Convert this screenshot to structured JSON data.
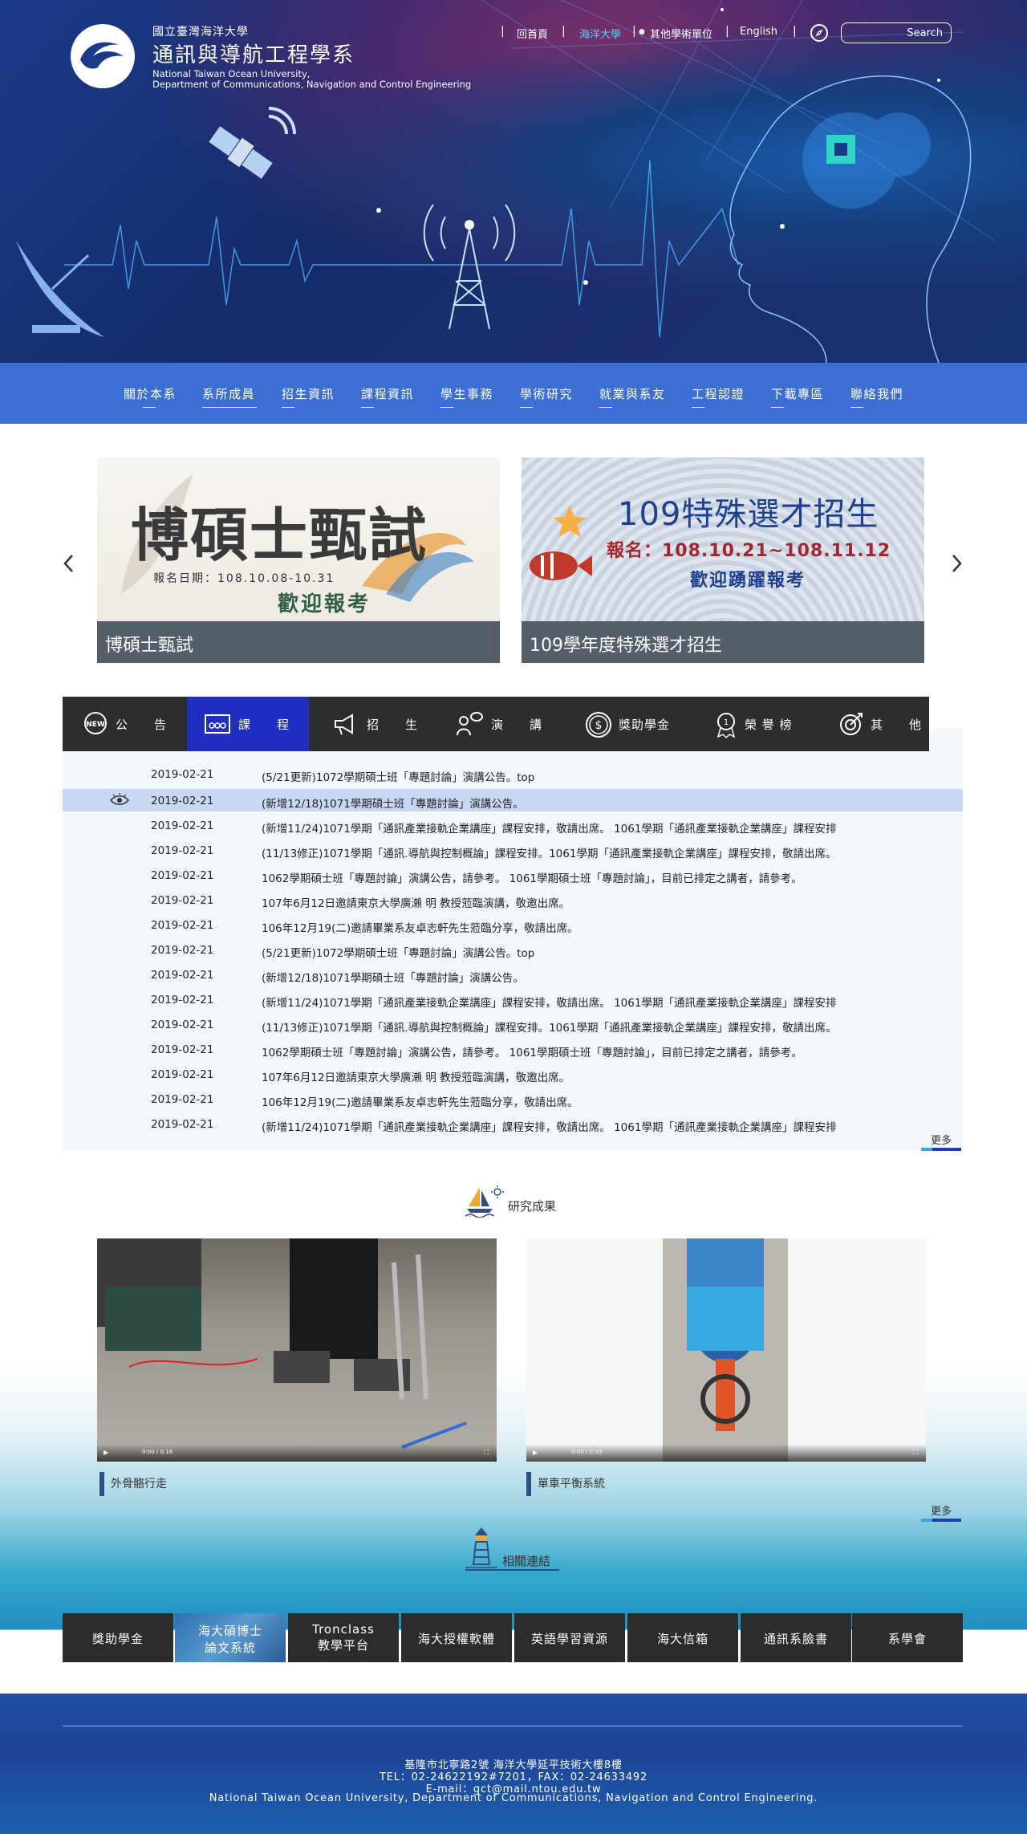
{
  "header": {
    "uni_zh": "國立臺灣海洋大學",
    "dept_zh": "通訊與導航工程學系",
    "uni_en": "National Taiwan Ocean University,",
    "dept_en": "Department of Communications, Navigation and Control Engineering",
    "topnav": [
      "回首頁",
      "海洋大學",
      "其他學術單位",
      "English"
    ],
    "search_label": "Search",
    "accent": "#4fd1ff"
  },
  "mainnav": [
    "關於本系",
    "系所成員",
    "招生資訊",
    "課程資訊",
    "學生事務",
    "學術研究",
    "就業與系友",
    "工程認證",
    "下載專區",
    "聯絡我們"
  ],
  "slides": [
    {
      "title": "博碩士甄試",
      "img_title": "博碩士甄試",
      "img_sub": "報名日期：108.10.08-10.31",
      "img_welcome": "歡迎報考"
    },
    {
      "title": "109學年度特殊選才招生",
      "img_title": "109特殊選才招生",
      "img_sub": "報名：108.10.21~108.11.12",
      "img_welcome": "歡迎踴躍報考"
    }
  ],
  "tabs": [
    "公　　告",
    "課　　程",
    "招　　生",
    "演　　講",
    "獎助學金",
    "榮 譽 榜",
    "其　　他"
  ],
  "news": [
    {
      "date": "2019-02-21",
      "title": "(5/21更新)1072學期碩士班「專題討論」演講公告。top"
    },
    {
      "date": "2019-02-21",
      "title": "(新增12/18)1071學期碩士班「專題討論」演講公告。"
    },
    {
      "date": "2019-02-21",
      "title": "(新增11/24)1071學期「通訊產業接軌企業講座」課程安排，敬請出席。 1061學期「通訊產業接軌企業講座」課程安排"
    },
    {
      "date": "2019-02-21",
      "title": "(11/13修正)1071學期「通訊.導航與控制概論」課程安排。1061學期「通訊產業接軌企業講座」課程安排，敬請出席。"
    },
    {
      "date": "2019-02-21",
      "title": "1062學期碩士班「專題討論」演講公告，請參考。 1061學期碩士班「專題討論」，目前已排定之講者，請參考。"
    },
    {
      "date": "2019-02-21",
      "title": "107年6月12日邀請東京大學廣瀨 明 教授蒞臨演講，敬邀出席。"
    },
    {
      "date": "2019-02-21",
      "title": "106年12月19(二)邀請畢業系友卓志軒先生蒞臨分享，敬請出席。"
    },
    {
      "date": "2019-02-21",
      "title": "(5/21更新)1072學期碩士班「專題討論」演講公告。top"
    },
    {
      "date": "2019-02-21",
      "title": "(新增12/18)1071學期碩士班「專題討論」演講公告。"
    },
    {
      "date": "2019-02-21",
      "title": "(新增11/24)1071學期「通訊產業接軌企業講座」課程安排，敬請出席。 1061學期「通訊產業接軌企業講座」課程安排"
    },
    {
      "date": "2019-02-21",
      "title": "(11/13修正)1071學期「通訊.導航與控制概論」課程安排。1061學期「通訊產業接軌企業講座」課程安排，敬請出席。"
    },
    {
      "date": "2019-02-21",
      "title": "1062學期碩士班「專題討論」演講公告，請參考。 1061學期碩士班「專題討論」，目前已排定之講者，請參考。"
    },
    {
      "date": "2019-02-21",
      "title": "107年6月12日邀請東京大學廣瀨 明 教授蒞臨演講，敬邀出席。"
    },
    {
      "date": "2019-02-21",
      "title": "106年12月19(二)邀請畢業系友卓志軒先生蒞臨分享，敬請出席。"
    },
    {
      "date": "2019-02-21",
      "title": "(新增11/24)1071學期「通訊產業接軌企業講座」課程安排，敬請出席。 1061學期「通訊產業接軌企業講座」課程安排"
    }
  ],
  "more_label": "更多",
  "research": {
    "heading": "研究成果",
    "videos": [
      {
        "caption": "外骨骼行走",
        "time": "0:00 / 0:16"
      },
      {
        "caption": "單車平衡系統",
        "time": "0:00 / 0:33"
      }
    ]
  },
  "links": {
    "heading": "相關連結",
    "items": [
      [
        "獎助學金"
      ],
      [
        "海大碩博士",
        "論文系統"
      ],
      [
        "Tronclass",
        "教學平台"
      ],
      [
        "海大授權軟體"
      ],
      [
        "英語學習資源"
      ],
      [
        "海大信箱"
      ],
      [
        "通訊系臉書"
      ],
      [
        "系學會"
      ]
    ]
  },
  "footer": {
    "address": "基隆市北寧路2號 海洋大學延平技術大樓8樓",
    "tel": "TEL：02-24622192#7201，FAX：02-24633492",
    "email": "E-mail：gct@mail.ntou.edu.tw",
    "name": "National Taiwan Ocean University, Department of Communications, Navigation and Control Engineering."
  }
}
